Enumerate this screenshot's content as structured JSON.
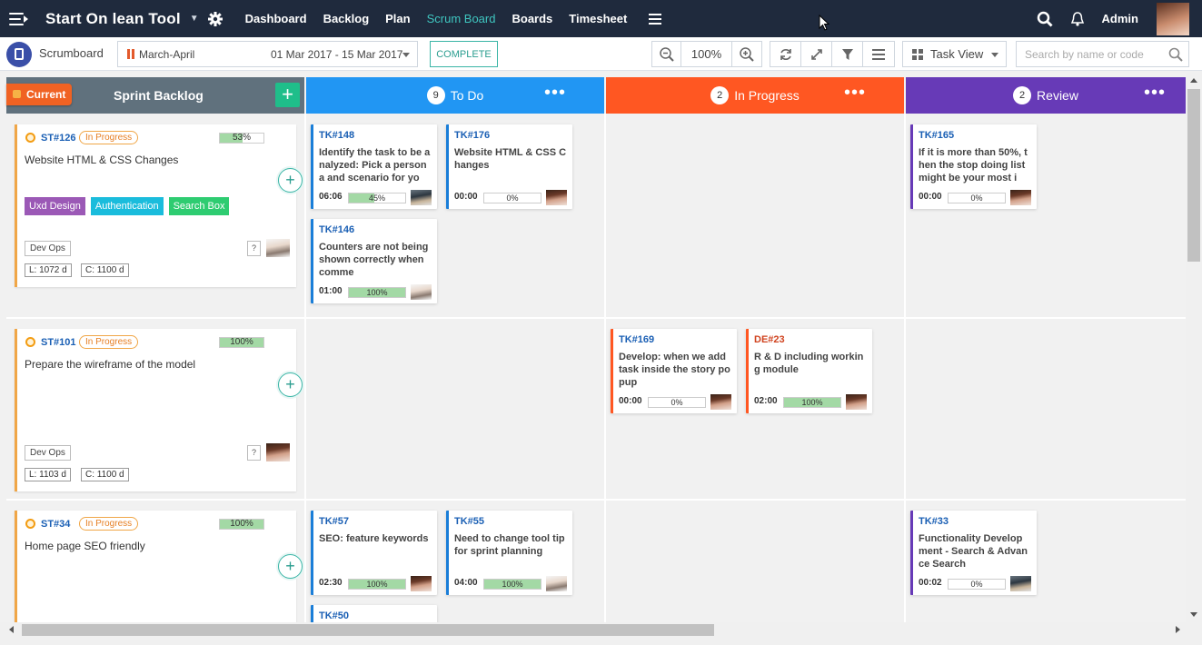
{
  "app": {
    "title": "Start On lean Tool"
  },
  "nav": {
    "items": [
      "Dashboard",
      "Backlog",
      "Plan",
      "Scrum Board",
      "Boards",
      "Timesheet"
    ],
    "active": "Scrum Board",
    "user": "Admin"
  },
  "toolbar": {
    "title": "Scrumboard",
    "sprint_name": "March-April",
    "sprint_dates": "01 Mar 2017 - 15 Mar 2017",
    "complete_label": "COMPLETE",
    "zoom": "100%",
    "view_label": "Task View",
    "search_placeholder": "Search by name or code"
  },
  "backlog": {
    "current_label": "Current",
    "title": "Sprint Backlog",
    "add_label": "+"
  },
  "columns": [
    {
      "name": "To Do",
      "count": "9",
      "color": "#2196f3"
    },
    {
      "name": "In Progress",
      "count": "2",
      "color": "#ff5722"
    },
    {
      "name": "Review",
      "count": "2",
      "color": "#673ab7"
    }
  ],
  "stories": [
    {
      "id": "ST#126",
      "status": "In Progress",
      "progress": "53%",
      "progress_value": 53,
      "title": "Website HTML & CSS Changes",
      "tags": [
        {
          "label": "Uxd Design",
          "color": "#9b59b6"
        },
        {
          "label": "Authentication",
          "color": "#1abcdc"
        },
        {
          "label": "Search Box",
          "color": "#2ecc71"
        }
      ],
      "team": "Dev Ops",
      "L": "L: 1072 d",
      "C": "C: 1100 d",
      "q": "?"
    },
    {
      "id": "ST#101",
      "status": "In Progress",
      "progress": "100%",
      "progress_value": 100,
      "title": "Prepare the wireframe of the model",
      "tags": [],
      "team": "Dev Ops",
      "L": "L: 1103 d",
      "C": "C: 1100 d",
      "q": "?"
    },
    {
      "id": "ST#34",
      "status": "In Progress",
      "progress": "100%",
      "progress_value": 100,
      "title": "Home page SEO friendly",
      "tags": []
    }
  ],
  "tasks": {
    "row1_todo_a": {
      "id": "TK#148",
      "title": "Identify the task to be analyzed: Pick a persona and scenario for yo",
      "time": "06:06",
      "progress": "45%",
      "progress_value": 45
    },
    "row1_todo_b": {
      "id": "TK#176",
      "title": "Website HTML & CSS Changes",
      "time": "00:00",
      "progress": "0%",
      "progress_value": 0
    },
    "row1_todo_c": {
      "id": "TK#146",
      "title": "Counters are not being shown correctly when comme",
      "time": "01:00",
      "progress": "100%",
      "progress_value": 100
    },
    "row1_review": {
      "id": "TK#165",
      "title": "If it is more than 50%, then the stop doing list might be your most i",
      "time": "00:00",
      "progress": "0%",
      "progress_value": 0
    },
    "row2_prog_a": {
      "id": "TK#169",
      "title": "Develop: when we add task inside the story popup",
      "time": "00:00",
      "progress": "0%",
      "progress_value": 0
    },
    "row2_prog_b": {
      "id": "DE#23",
      "title": "R & D including working module",
      "time": "02:00",
      "progress": "100%",
      "progress_value": 100
    },
    "row3_todo_a": {
      "id": "TK#57",
      "title": "SEO: feature keywords",
      "time": "02:30",
      "progress": "100%",
      "progress_value": 100
    },
    "row3_todo_b": {
      "id": "TK#55",
      "title": "Need to change tool tip for sprint planning",
      "time": "04:00",
      "progress": "100%",
      "progress_value": 100
    },
    "row3_todo_c": {
      "id": "TK#50"
    },
    "row3_review": {
      "id": "TK#33",
      "title": "Functionality Development - Search & Advance Search",
      "time": "00:02",
      "progress": "0%",
      "progress_value": 0
    }
  },
  "colors": {
    "nav_bg": "#1f2a3d",
    "accent": "#3fc6c0",
    "story_border": "#f0a647",
    "task_id_blue": "#1a5fb4",
    "task_id_red": "#d0431f"
  }
}
